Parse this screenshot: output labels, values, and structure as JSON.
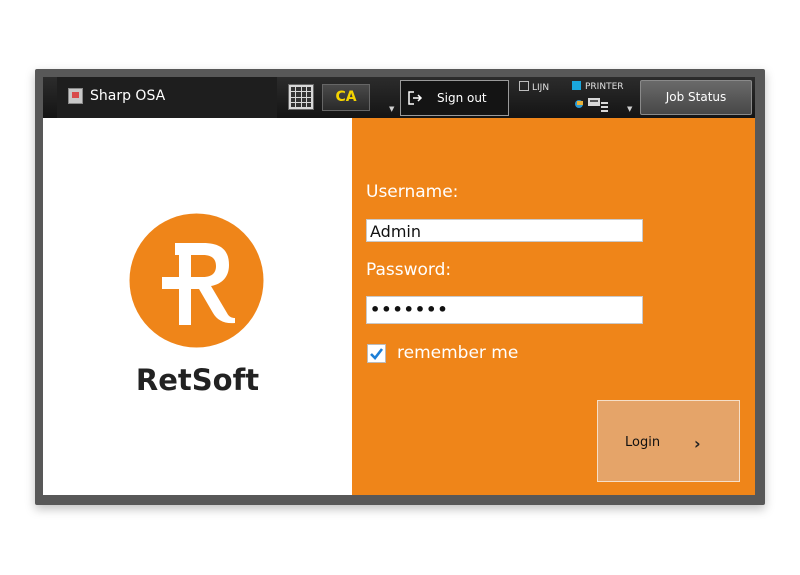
{
  "header": {
    "app_title": "Sharp OSA",
    "ca_label": "CA",
    "signout_label": "Sign out",
    "lijn_label": "LIJN",
    "printer_label": "PRINTER",
    "job_status_label": "Job Status"
  },
  "brand": {
    "name": "RetSoft",
    "logo_letter": "R",
    "logo_color": "#ef8519"
  },
  "login": {
    "username_label": "Username:",
    "username_value": "Admin",
    "password_label": "Password:",
    "password_value": "•••••••",
    "remember_label": "remember me",
    "remember_checked": true,
    "login_button_label": "Login",
    "login_chevron": "›"
  },
  "colors": {
    "accent": "#ef8519",
    "printer_indicator": "#1aa7dd",
    "ca_text": "#f5d400",
    "checkbox_check": "#1d7fd6"
  }
}
